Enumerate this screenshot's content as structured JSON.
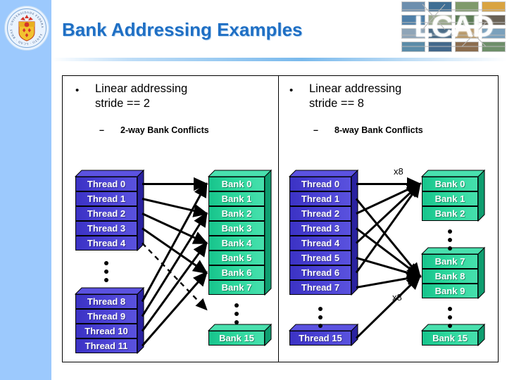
{
  "slide": {
    "title": "Bank Addressing Examples",
    "brand_wordmark": "LCAD",
    "seal_name": "university-seal"
  },
  "left_panel": {
    "bullet_marker": "•",
    "bullet_text": "Linear addressing\nstride == 2",
    "sub_dash": "–",
    "sub_text": "2-way Bank Conflicts",
    "threads_top": [
      "Thread 0",
      "Thread 1",
      "Thread 2",
      "Thread 3",
      "Thread 4"
    ],
    "threads_bottom": [
      "Thread 8",
      "Thread 9",
      "Thread 10",
      "Thread 11"
    ],
    "banks_top": [
      "Bank 0",
      "Bank 1",
      "Bank 2",
      "Bank 3",
      "Bank 4",
      "Bank 5",
      "Bank 6",
      "Bank 7"
    ],
    "banks_bottom": [
      "Bank 15"
    ]
  },
  "right_panel": {
    "bullet_marker": "•",
    "bullet_text": "Linear addressing\nstride == 8",
    "sub_dash": "–",
    "sub_text": "8-way Bank Conflicts",
    "threads_top": [
      "Thread 0",
      "Thread 1",
      "Thread 2",
      "Thread 3",
      "Thread 4",
      "Thread 5",
      "Thread 6",
      "Thread 7"
    ],
    "threads_bottom": [
      "Thread 15"
    ],
    "banks_top": [
      "Bank 0",
      "Bank 1",
      "Bank 2"
    ],
    "banks_mid": [
      "Bank 7",
      "Bank 8",
      "Bank 9"
    ],
    "banks_bottom": [
      "Bank 15"
    ],
    "multiplier_top": "x8",
    "multiplier_bottom": "x8"
  },
  "colors": {
    "title": "#1f6fc4",
    "sidebar": "#9cc9fd",
    "thread_box": "#4a41d4",
    "bank_box": "#2dd69c",
    "arrow": "#000000"
  },
  "collage_tiles": [
    "#6d8fae",
    "#3f6e94",
    "#7f9a6b",
    "#d9a441",
    "#4f7fa8",
    "#9aa88c",
    "#5d7c57",
    "#6a6256",
    "#8fa5b8",
    "#4a6b86",
    "#b89a6c",
    "#7aa0bc",
    "#5b8ca8",
    "#43688b",
    "#8b6d4f",
    "#6e8f6a"
  ]
}
